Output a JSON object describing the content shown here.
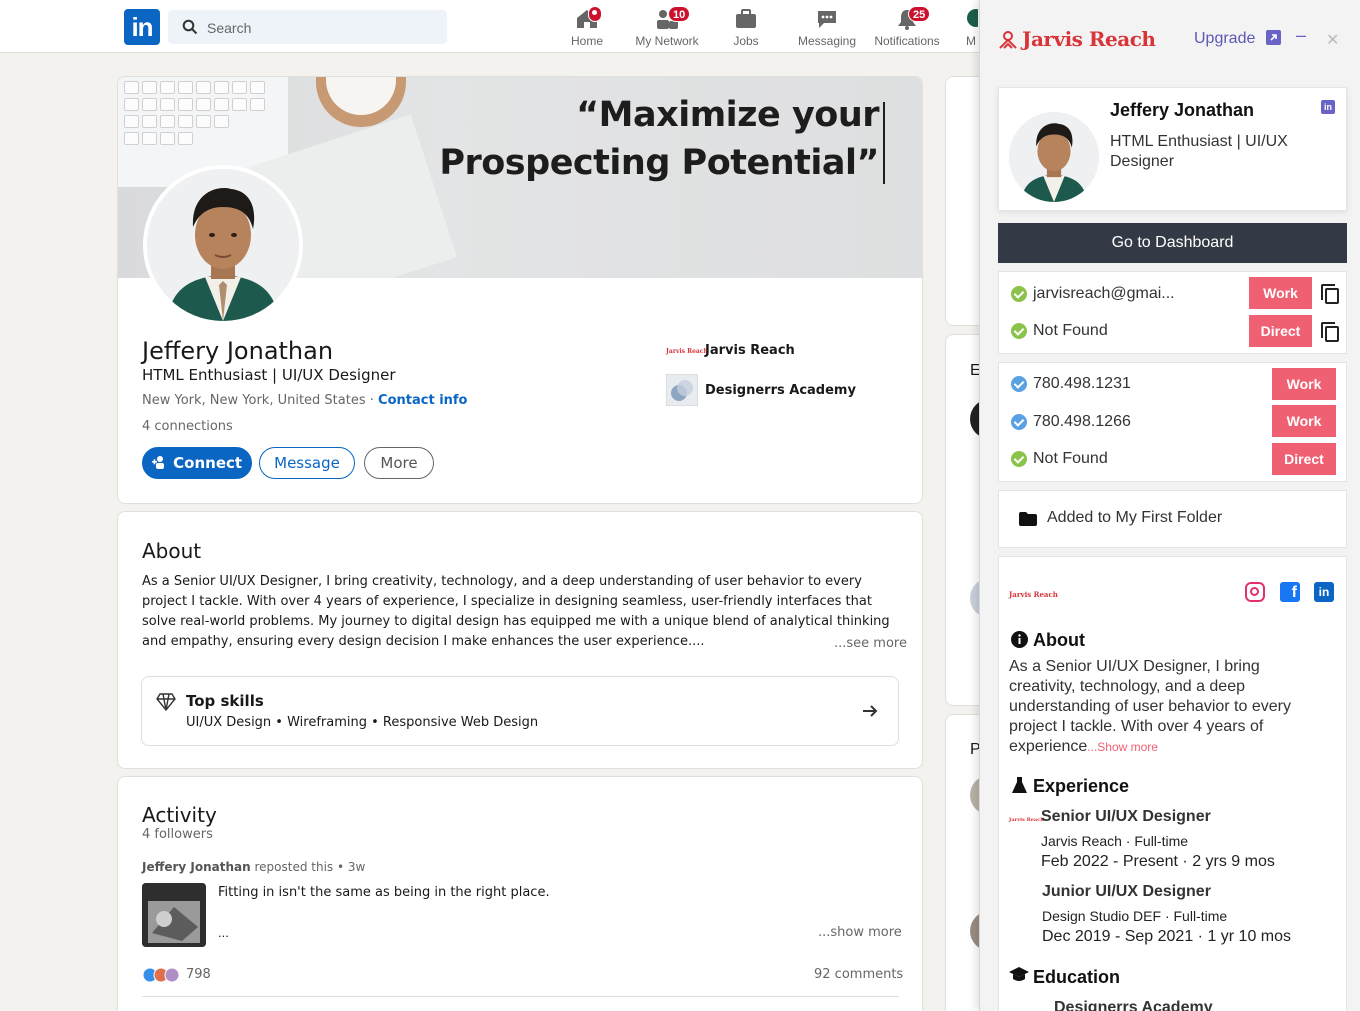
{
  "topbar": {
    "logo": "in",
    "search_placeholder": "Search",
    "nav": [
      {
        "label": "Home",
        "icon": "home-icon",
        "badge": ""
      },
      {
        "label": "My Network",
        "icon": "network-icon",
        "badge": "10"
      },
      {
        "label": "Jobs",
        "icon": "briefcase-icon",
        "badge": ""
      },
      {
        "label": "Messaging",
        "icon": "message-icon",
        "badge": ""
      },
      {
        "label": "Notifications",
        "icon": "bell-icon",
        "badge": "25"
      },
      {
        "label": "M",
        "icon": "me-icon",
        "badge": ""
      }
    ]
  },
  "profile": {
    "banner_line1": "“Maximize your",
    "banner_line2": "Prospecting Potential”",
    "name": "Jeffery Jonathan",
    "headline": "HTML Enthusiast | UI/UX Designer",
    "location": "New York, New York, United States",
    "contact_info": "Contact info",
    "connections": "4 connections",
    "buttons": {
      "connect": "Connect",
      "message": "Message",
      "more": "More"
    },
    "companies": [
      {
        "logo_text": "Jarvis Reach",
        "name": "Jarvis Reach"
      },
      {
        "name": "Designerrs Academy"
      }
    ]
  },
  "about": {
    "title": "About",
    "text": "As a Senior UI/UX Designer, I bring creativity, technology, and a deep understanding of user behavior to every project I tackle. With over 4 years of experience, I specialize in designing seamless, user-friendly interfaces that solve real-world problems. My journey to digital design has equipped me with a unique blend of analytical thinking and empathy, ensuring every design decision I make enhances the user experience....",
    "see_more": "...see more",
    "top_skills_title": "Top skills",
    "top_skills": "UI/UX Design • Wireframing • Responsive Web Design"
  },
  "activity": {
    "title": "Activity",
    "followers": "4 followers",
    "repost_name": "Jeffery Jonathan",
    "repost_meta": "reposted this • 3w",
    "post_text": "Fitting in isn't the same as being in the right place.",
    "post_ellipsis": "...",
    "show_more": "...show more",
    "reactions": "798",
    "comments": "92 comments"
  },
  "side": {
    "letter_e": "E",
    "letter_p": "P"
  },
  "panel": {
    "brand": "Jarvis Reach",
    "upgrade": "Upgrade",
    "minimize": "–",
    "close": "✕",
    "card": {
      "name": "Jeffery Jonathan",
      "headline": "HTML Enthusiast | UI/UX Designer"
    },
    "dashboard": "Go to Dashboard",
    "emails": [
      {
        "value": "jarvisreach@gmai...",
        "tag": "Work"
      },
      {
        "value": "Not Found",
        "tag": "Direct"
      }
    ],
    "phones": [
      {
        "value": "780.498.1231",
        "tag": "Work"
      },
      {
        "value": "780.498.1266",
        "tag": "Work"
      },
      {
        "value": "Not Found",
        "tag": "Direct"
      }
    ],
    "folder": "Added to My First Folder",
    "company_logo": "Jarvis Reach",
    "about_title": "About",
    "about_text": "As a Senior UI/UX Designer, I bring creativity, technology, and a deep understanding of user behavior to every project I tackle. With over 4 years of experience",
    "show_more": "...Show more",
    "experience_title": "Experience",
    "experience": [
      {
        "title": "Senior UI/UX Designer",
        "company": "Jarvis Reach · Full-time",
        "dates": "Feb 2022 - Present · 2 yrs 9 mos"
      },
      {
        "title": "Junior UI/UX Designer",
        "company": "Design Studio DEF · Full-time",
        "dates": "Dec 2019 - Sep 2021 · 1 yr 10 mos"
      }
    ],
    "education_title": "Education",
    "education_first": "Designerrs Academy"
  },
  "colors": {
    "linkedin_blue": "#0a66c2",
    "jarvis_red": "#d8343a",
    "tag_pink": "#f06073",
    "dark_button": "#343a45",
    "upgrade_purple": "#5b58b6"
  }
}
